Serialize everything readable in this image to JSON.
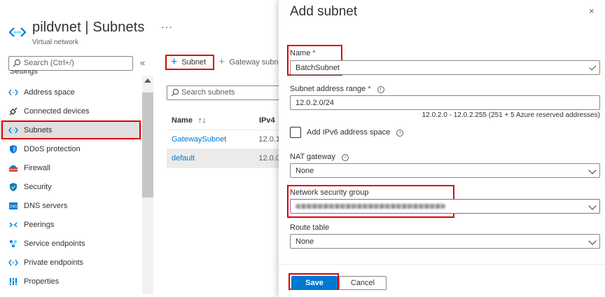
{
  "resource": {
    "name": "pildvnet",
    "separator": "|",
    "section": "Subnets",
    "type": "Virtual network",
    "more": "···",
    "icon": "vnet-icon"
  },
  "nav": {
    "search_placeholder": "Search (Ctrl+/)",
    "collapse": "«",
    "group_label": "Settings",
    "items": [
      {
        "label": "Address space",
        "icon": "address-space-icon"
      },
      {
        "label": "Connected devices",
        "icon": "plug-icon"
      },
      {
        "label": "Subnets",
        "icon": "subnets-icon",
        "active": true
      },
      {
        "label": "DDoS protection",
        "icon": "shield-icon"
      },
      {
        "label": "Firewall",
        "icon": "firewall-icon"
      },
      {
        "label": "Security",
        "icon": "security-shield-icon"
      },
      {
        "label": "DNS servers",
        "icon": "dns-icon"
      },
      {
        "label": "Peerings",
        "icon": "peerings-icon"
      },
      {
        "label": "Service endpoints",
        "icon": "service-endpoints-icon"
      },
      {
        "label": "Private endpoints",
        "icon": "private-endpoints-icon"
      },
      {
        "label": "Properties",
        "icon": "properties-icon"
      }
    ]
  },
  "toolbar": {
    "add_subnet": "Subnet",
    "add_gateway": "Gateway subn"
  },
  "subnets": {
    "search_placeholder": "Search subnets",
    "columns": [
      "Name",
      "IPv4"
    ],
    "sort_indicator": "↑↓",
    "rows": [
      {
        "name": "GatewaySubnet",
        "ipv4": "12.0.1"
      },
      {
        "name": "default",
        "ipv4": "12.0.0"
      }
    ]
  },
  "panel": {
    "title": "Add subnet",
    "close": "×",
    "name_label": "Name",
    "required_mark": "*",
    "name_value": "BatchSubnet",
    "range_label": "Subnet address range",
    "range_value": "12.0.2.0/24",
    "range_hint": "12.0.2.0 - 12.0.2.255 (251 + 5 Azure reserved addresses)",
    "ipv6_label": "Add IPv6 address space",
    "info": "i",
    "nat_label": "NAT gateway",
    "nat_value": "None",
    "nsg_label": "Network security group",
    "route_label": "Route table",
    "route_value": "None",
    "save": "Save",
    "cancel": "Cancel"
  },
  "colors": {
    "accent": "#0078d4",
    "highlight": "#e00000",
    "valid": "#107c10"
  }
}
